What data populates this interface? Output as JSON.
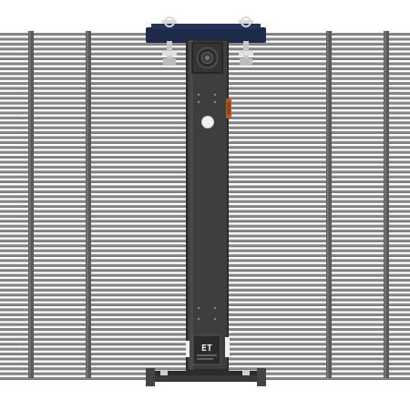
{
  "colors": {
    "background": "#ffffff",
    "slat": "#8a8a8a",
    "slat_shadow": "#6e6e6e",
    "post": "#5a5a5a",
    "spine_body": "#3e3e3e",
    "spine_edge": "#2a2a2a",
    "bracket": "#1e2a4a",
    "hardware": "#c8c8c8",
    "accent": "#b55a2a",
    "port": "#f2f2f2",
    "logo_plate": "#2b2b2b"
  },
  "icons": {
    "speaker": "speaker-icon",
    "logo": "logo-mark-icon"
  },
  "logo": {
    "mark": "ET"
  }
}
